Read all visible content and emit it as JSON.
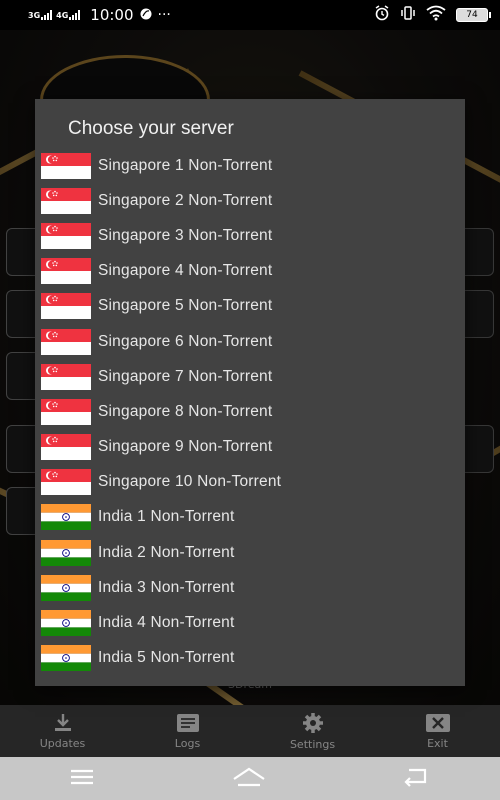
{
  "status_bar": {
    "signal1": "3G",
    "signal2": "4G",
    "time": "10:00",
    "more": "···",
    "battery": "74"
  },
  "dialog": {
    "title": "Choose your server",
    "servers": [
      {
        "label": "Singapore 1 Non-Torrent",
        "flag": "singapore"
      },
      {
        "label": "Singapore 2 Non-Torrent",
        "flag": "singapore"
      },
      {
        "label": "Singapore 3 Non-Torrent",
        "flag": "singapore"
      },
      {
        "label": "Singapore 4 Non-Torrent",
        "flag": "singapore"
      },
      {
        "label": "Singapore 5 Non-Torrent",
        "flag": "singapore"
      },
      {
        "label": "Singapore 6 Non-Torrent",
        "flag": "singapore"
      },
      {
        "label": "Singapore 7 Non-Torrent",
        "flag": "singapore"
      },
      {
        "label": "Singapore 8 Non-Torrent",
        "flag": "singapore"
      },
      {
        "label": "Singapore 9 Non-Torrent",
        "flag": "singapore"
      },
      {
        "label": "Singapore 10 Non-Torrent",
        "flag": "singapore"
      },
      {
        "label": "India 1 Non-Torrent",
        "flag": "india"
      },
      {
        "label": "India 2 Non-Torrent",
        "flag": "india"
      },
      {
        "label": "India 3 Non-Torrent",
        "flag": "india"
      },
      {
        "label": "India 4 Non-Torrent",
        "flag": "india"
      },
      {
        "label": "India 5 Non-Torrent",
        "flag": "india"
      }
    ]
  },
  "background": {
    "footer_text": "~SDream~"
  },
  "bottom_bar": {
    "tabs": [
      {
        "label": "Updates",
        "icon": "download-icon"
      },
      {
        "label": "Logs",
        "icon": "document-icon"
      },
      {
        "label": "Settings",
        "icon": "gear-icon"
      },
      {
        "label": "Exit",
        "icon": "close-box-icon"
      }
    ]
  },
  "nav_bar": {
    "buttons": [
      "menu-icon",
      "home-icon",
      "back-icon"
    ]
  },
  "colors": {
    "dialog_bg": "#424242",
    "gold": "#c9a356",
    "bottom_bar_bg": "#3b3b3b",
    "nav_bar_bg": "#c7c7c7"
  }
}
